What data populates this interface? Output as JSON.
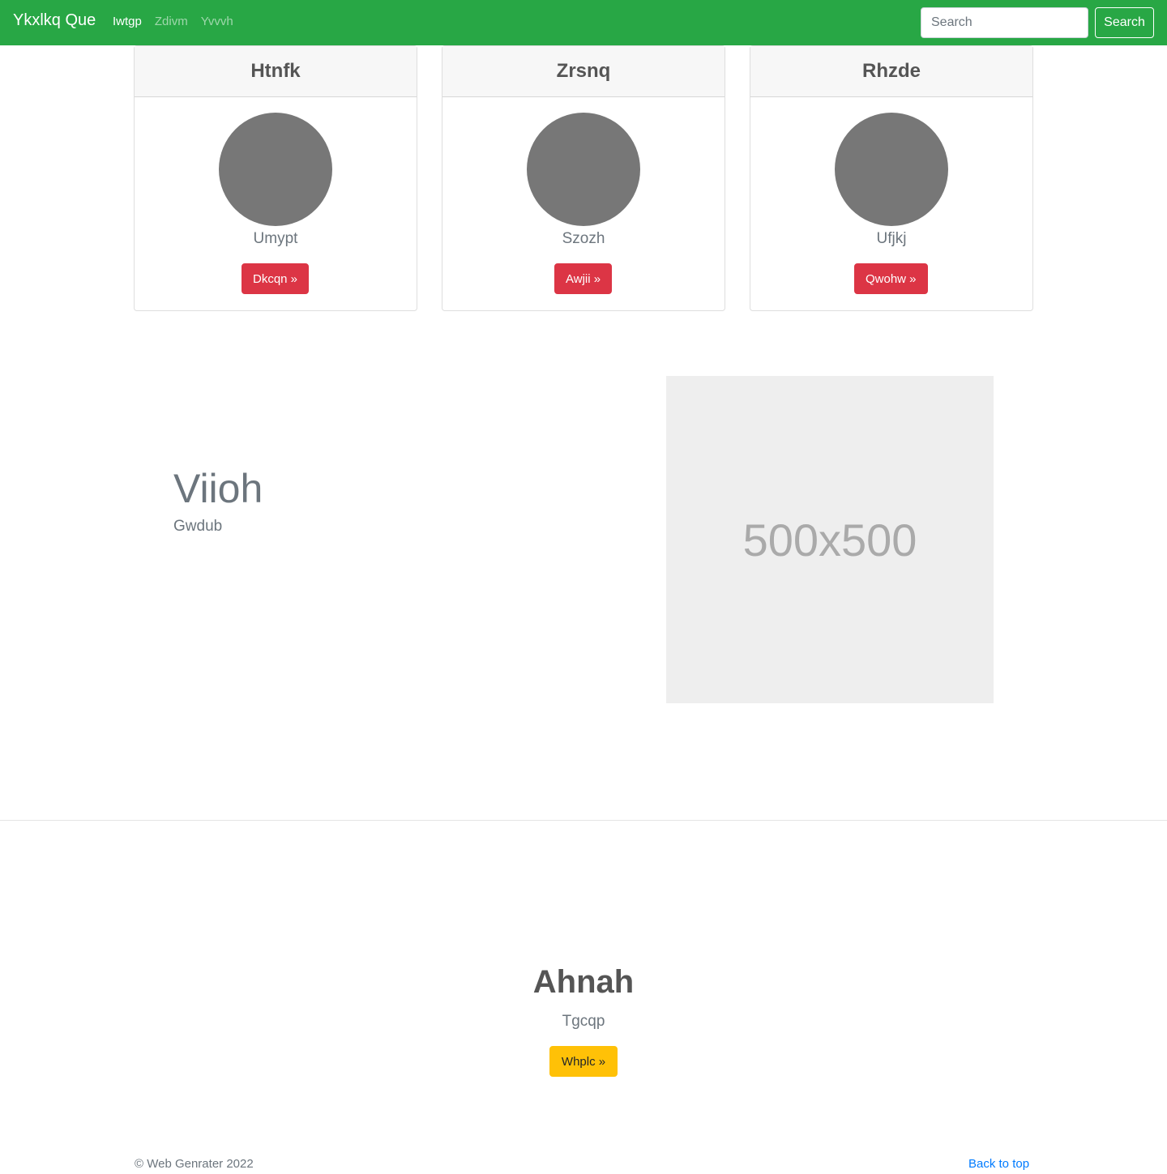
{
  "navbar": {
    "brand": "Ykxlkq Que",
    "links": [
      {
        "label": "Iwtgp",
        "active": true
      },
      {
        "label": "Zdivm",
        "active": false
      },
      {
        "label": "Yvvvh",
        "active": false
      }
    ],
    "search": {
      "placeholder": "Search",
      "value": "",
      "button_label": "Search"
    }
  },
  "cards": [
    {
      "title": "Htnfk",
      "text": "Umypt",
      "button_label": "Dkcqn »"
    },
    {
      "title": "Zrsnq",
      "text": "Szozh",
      "button_label": "Awjii »"
    },
    {
      "title": "Rhzde",
      "text": "Ufjkj",
      "button_label": "Qwohw »"
    }
  ],
  "feature": {
    "title": "Viioh",
    "subtitle": "Gwdub",
    "image_label": "500x500"
  },
  "jumbotron": {
    "title": "Ahnah",
    "subtitle": "Tgcqp",
    "button_label": "Whplc »"
  },
  "footer": {
    "copyright": "© Web Genrater 2022",
    "back_to_top": "Back to top"
  },
  "colors": {
    "navbar": "#28a745",
    "card_button": "#dc3545",
    "jumbo_button": "#ffc107",
    "link": "#007bff",
    "avatar": "#777777"
  }
}
